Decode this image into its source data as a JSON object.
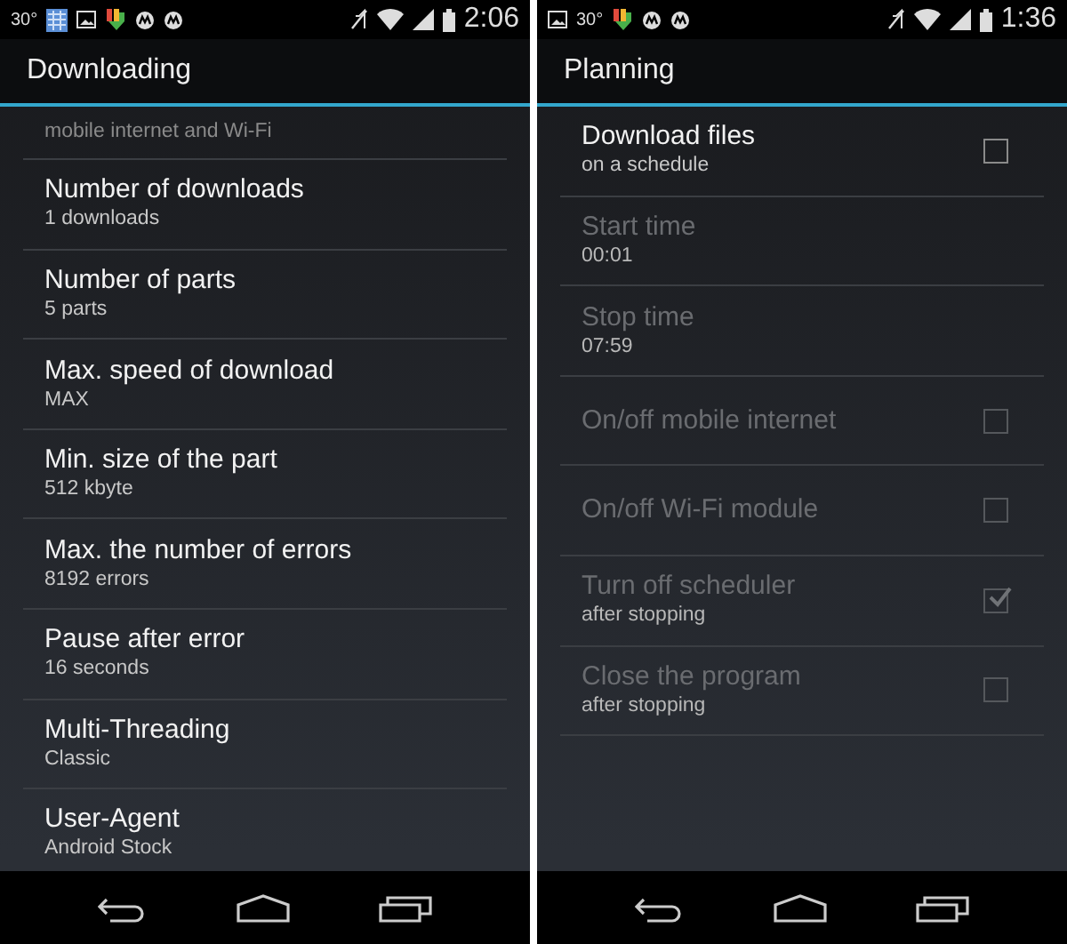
{
  "screens": [
    {
      "status_bar": {
        "left": [
          {
            "kind": "text",
            "text": "30°"
          },
          {
            "kind": "grid"
          },
          {
            "kind": "image"
          },
          {
            "kind": "download"
          },
          {
            "kind": "circle"
          },
          {
            "kind": "circle"
          }
        ],
        "time": "2:06"
      },
      "title": "Downloading",
      "items": [
        {
          "kind": "partial",
          "subtitle": "mobile internet and Wi-Fi",
          "disabled": false
        },
        {
          "kind": "text",
          "title": "Number of downloads",
          "subtitle": "1 downloads",
          "disabled": false
        },
        {
          "kind": "text",
          "title": "Number of parts",
          "subtitle": "5 parts",
          "disabled": false
        },
        {
          "kind": "text",
          "title": "Max. speed of download",
          "subtitle": "MAX",
          "disabled": false
        },
        {
          "kind": "text",
          "title": "Min. size of the part",
          "subtitle": "512 kbyte",
          "disabled": false
        },
        {
          "kind": "text",
          "title": "Max. the number of errors",
          "subtitle": "8192 errors",
          "disabled": false
        },
        {
          "kind": "text",
          "title": "Pause after error",
          "subtitle": "16 seconds",
          "disabled": false
        },
        {
          "kind": "text",
          "title": "Multi-Threading",
          "subtitle": "Classic",
          "disabled": false
        },
        {
          "kind": "text",
          "title": "User-Agent",
          "subtitle": "Android Stock",
          "disabled": false
        }
      ]
    },
    {
      "status_bar": {
        "left": [
          {
            "kind": "image"
          },
          {
            "kind": "text",
            "text": "30°"
          },
          {
            "kind": "download"
          },
          {
            "kind": "circle"
          },
          {
            "kind": "circle"
          }
        ],
        "time": "1:36"
      },
      "title": "Planning",
      "items": [
        {
          "kind": "checkbox",
          "title": "Download files",
          "subtitle": "on a schedule",
          "disabled": false,
          "checked": false
        },
        {
          "kind": "text",
          "title": "Start time",
          "subtitle": "00:01",
          "disabled": true
        },
        {
          "kind": "text",
          "title": "Stop time",
          "subtitle": "07:59",
          "disabled": true
        },
        {
          "kind": "checkbox",
          "title": "On/off mobile internet",
          "disabled": true,
          "checked": false
        },
        {
          "kind": "checkbox",
          "title": "On/off Wi-Fi module",
          "disabled": true,
          "checked": false
        },
        {
          "kind": "checkbox",
          "title": "Turn off scheduler",
          "subtitle": "after stopping",
          "disabled": true,
          "checked": true
        },
        {
          "kind": "checkbox",
          "title": "Close the program",
          "subtitle": "after stopping",
          "disabled": true,
          "checked": false
        }
      ]
    }
  ]
}
